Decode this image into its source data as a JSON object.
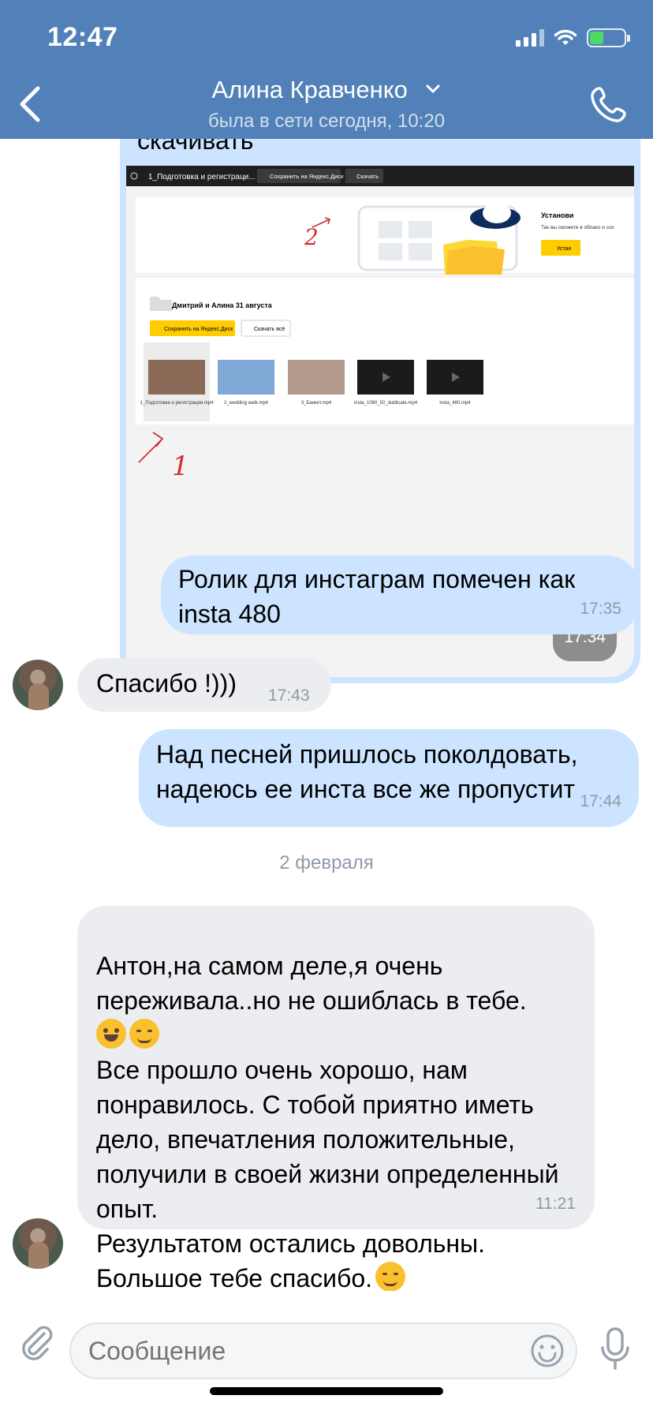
{
  "status_bar": {
    "time": "12:47"
  },
  "header": {
    "contact_name": "Алина Кравченко",
    "contact_status": "была в сети сегодня, 10:20"
  },
  "colors": {
    "header": "#5181b8",
    "outgoing_bubble": "#cce4ff",
    "incoming_bubble": "#ebedf0"
  },
  "messages": [
    {
      "direction": "out",
      "text": "скачивать",
      "time": "17:34",
      "attachment": {
        "tab_title": "1_Подготовка и регистраци...",
        "save_disk_label": "Сохранить на Яндекс.Диск",
        "download_label": "Скачать",
        "banner_title": "Установи",
        "banner_text": "Так вы сможете в облако и сох",
        "banner_btn": "Устан",
        "folder_title": "Дмитрий и Алина 31 августа",
        "save_btn": "Сохранить на Яндекс.Диск",
        "download_all": "Скачать всё",
        "files": [
          "1_Подготовка и регистрация.mp4",
          "2_wedding walk.mp4",
          "3_Банкет.mp4",
          "insta_1080_50_dublicate.mp4",
          "insta_480.mp4"
        ],
        "annotation_1": "1",
        "annotation_2": "2"
      }
    },
    {
      "direction": "out",
      "text": "Ролик для инстаграм помечен как insta 480",
      "time": "17:35"
    },
    {
      "direction": "in",
      "text": "Спасибо !)))",
      "time": "17:43"
    },
    {
      "direction": "out",
      "text": "Над песней пришлось поколдовать, надеюсь ее инста все же пропустит",
      "time": "17:44"
    },
    {
      "direction": "in",
      "text_part1": "Антон,на самом деле,я очень переживала..но не ошиблась в тебе.",
      "text_part2": "Все прошло очень хорошо, нам понравилось. С тобой  приятно иметь дело, впечатления положительные, получили в своей жизни определенный опыт.\nРезультатом остались  довольны.\nБольшое тебе спасибо.",
      "time": "11:21"
    }
  ],
  "date_separator": "2 февраля",
  "composer": {
    "placeholder": "Сообщение"
  }
}
